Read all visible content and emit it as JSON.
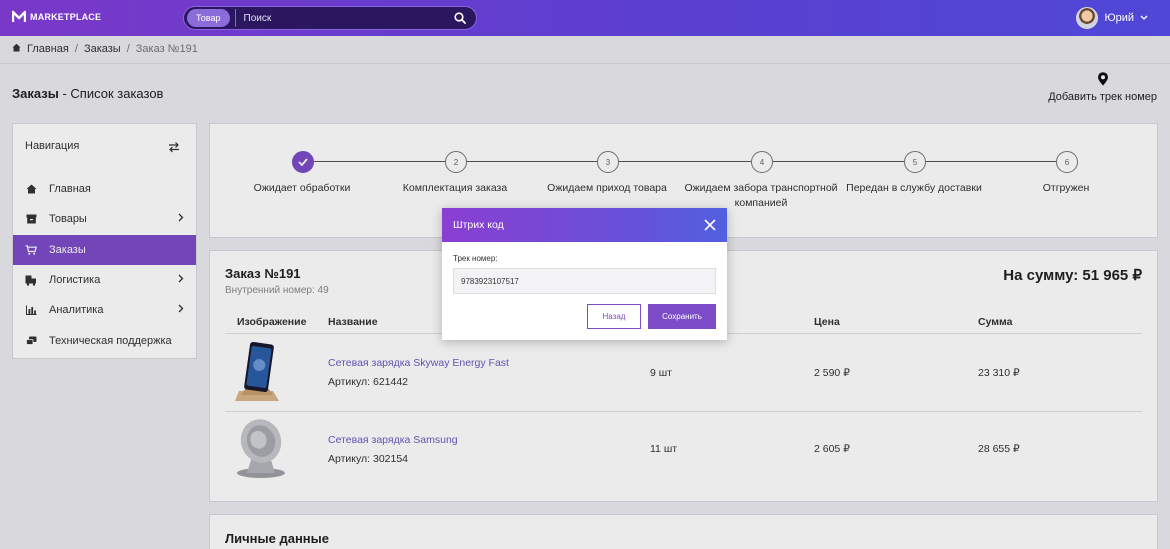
{
  "app": {
    "logo_text": "MARKETPLACE",
    "accent": "#7c4cc9"
  },
  "search": {
    "chip": "Товар",
    "placeholder": "Поиск"
  },
  "user": {
    "name": "Юрий"
  },
  "breadcrumb": {
    "home": "Главная",
    "orders": "Заказы",
    "current": "Заказ №191"
  },
  "page": {
    "title_bold": "Заказы",
    "title_rest": " - Список заказов",
    "add_track": "Добавить трек номер"
  },
  "nav": {
    "heading": "Навигация",
    "items": [
      {
        "label": "Главная",
        "icon": "home-icon"
      },
      {
        "label": "Товары",
        "icon": "box-icon"
      },
      {
        "label": "Заказы",
        "icon": "cart-icon"
      },
      {
        "label": "Логистика",
        "icon": "truck-icon"
      },
      {
        "label": "Аналитика",
        "icon": "bar-chart-icon"
      },
      {
        "label": "Техническая поддержка",
        "icon": "support-icon"
      }
    ]
  },
  "steps": [
    {
      "num": "1",
      "label": "Ожидает обработки",
      "done": true
    },
    {
      "num": "2",
      "label": "Комплектация заказа"
    },
    {
      "num": "3",
      "label": "Ожидаем приход товара"
    },
    {
      "num": "4",
      "label": "Ожидаем забора транспортной компанией"
    },
    {
      "num": "5",
      "label": "Передан в службу доставки"
    },
    {
      "num": "6",
      "label": "Отгружен"
    }
  ],
  "order": {
    "title": "Заказ №191",
    "internal": "Внутренний номер: 49",
    "total": "На сумму: 51 965 ₽",
    "columns": [
      "Изображение",
      "Название",
      "Цена",
      "Сумма"
    ],
    "rows": [
      {
        "name": "Сетевая зарядка Skyway Energy Fast",
        "article": "Артикул: 621442",
        "qty": "9 шт",
        "price": "2 590 ₽",
        "sum": "23 310 ₽"
      },
      {
        "name": "Сетевая зарядка Samsung",
        "article": "Артикул: 302154",
        "qty": "11 шт",
        "price": "2 605 ₽",
        "sum": "28 655 ₽"
      }
    ]
  },
  "personal": {
    "title": "Личные данные"
  },
  "modal": {
    "title": "Штрих код",
    "label": "Трек номер:",
    "value": "9783923107517",
    "back": "Назад",
    "save": "Сохранить"
  }
}
